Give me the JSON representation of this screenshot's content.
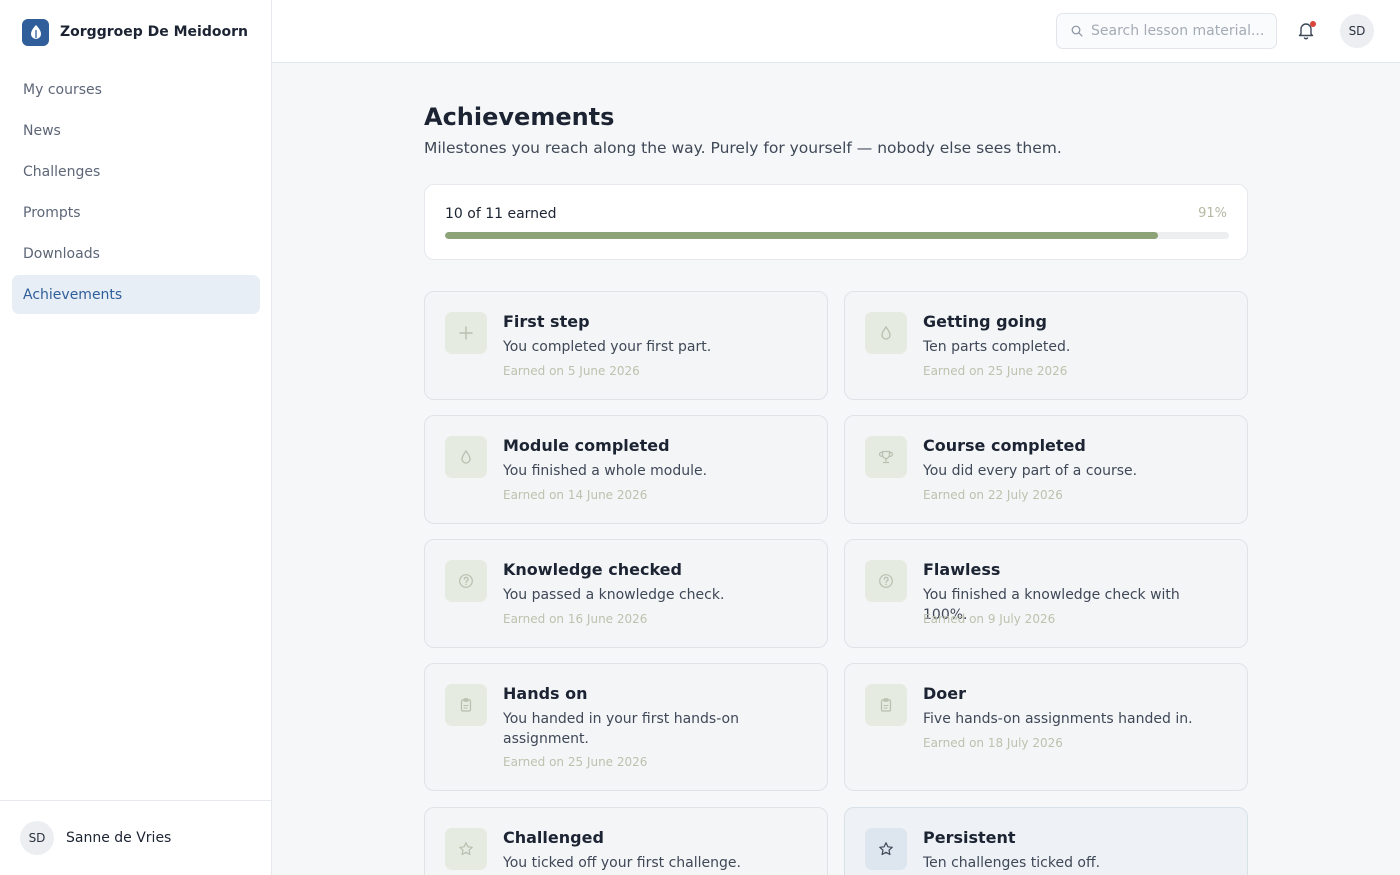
{
  "brand": {
    "name": "Zorggroep De Meidoorn",
    "color": "#2f5e9a"
  },
  "nav": [
    {
      "label": "My courses",
      "active": false
    },
    {
      "label": "News",
      "active": false
    },
    {
      "label": "Challenges",
      "active": false
    },
    {
      "label": "Prompts",
      "active": false
    },
    {
      "label": "Downloads",
      "active": false
    },
    {
      "label": "Achievements",
      "active": true
    }
  ],
  "user": {
    "initials": "SD",
    "name": "Sanne de Vries"
  },
  "topbar": {
    "search_placeholder": "Search lesson material...",
    "notification_unread": true
  },
  "page": {
    "title": "Achievements",
    "subtitle": "Milestones you reach along the way. Purely for yourself — nobody else sees them."
  },
  "progress": {
    "label": "10 of 11 earned",
    "percent_label": "91%",
    "fraction": 0.91
  },
  "achievements": [
    {
      "title": "First step",
      "description": "You completed your first part.",
      "date": "Earned on 5 June 2026",
      "icon": "plus-icon"
    },
    {
      "title": "Getting going",
      "description": "Ten parts completed.",
      "date": "Earned on 25 June 2026",
      "icon": "drop-icon"
    },
    {
      "title": "Module completed",
      "description": "You finished a whole module.",
      "date": "Earned on 14 June 2026",
      "icon": "drop-icon"
    },
    {
      "title": "Course completed",
      "description": "You did every part of a course.",
      "date": "Earned on 22 July 2026",
      "icon": "trophy-icon"
    },
    {
      "title": "Knowledge checked",
      "description": "You passed a knowledge check.",
      "date": "Earned on 16 June 2026",
      "icon": "question-icon"
    },
    {
      "title": "Flawless",
      "description": "You finished a knowledge check with 100%.",
      "date": "Earned on 9 July 2026",
      "icon": "question-icon"
    },
    {
      "title": "Hands on",
      "description": "You handed in your first hands-on assignment.",
      "date": "Earned on 25 June 2026",
      "icon": "clipboard-icon"
    },
    {
      "title": "Doer",
      "description": "Five hands-on assignments handed in.",
      "date": "Earned on 18 July 2026",
      "icon": "clipboard-icon"
    },
    {
      "title": "Challenged",
      "description": "You ticked off your first challenge.",
      "date": "",
      "icon": "star-icon"
    },
    {
      "title": "Persistent",
      "description": "Ten challenges ticked off.",
      "date": "",
      "icon": "star-icon"
    }
  ],
  "colors": {
    "accent": "#2f5e9a",
    "earned_green": "#8ca277",
    "notification": "#d9433a"
  }
}
